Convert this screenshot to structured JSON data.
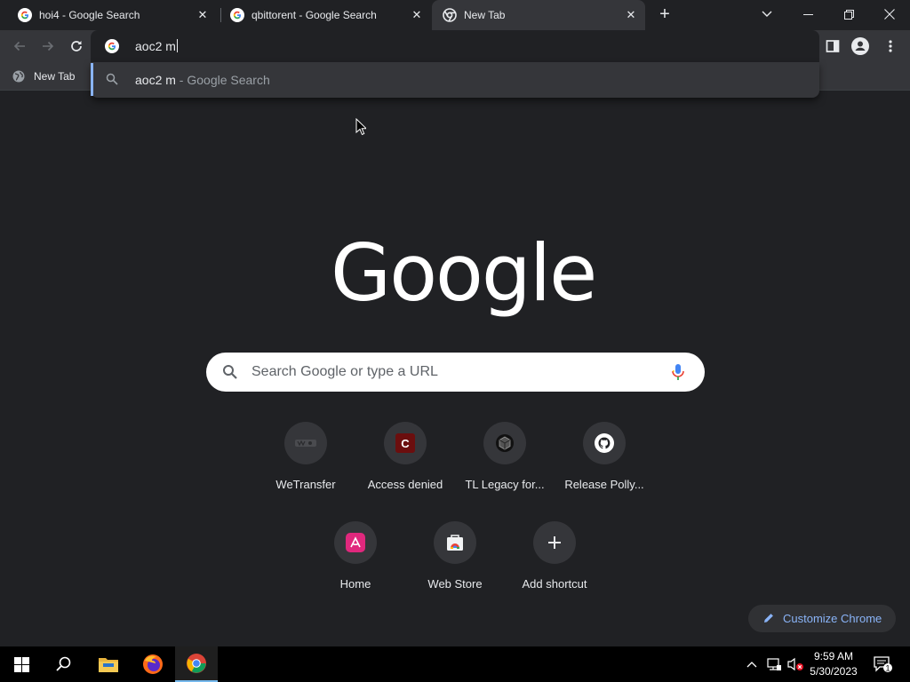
{
  "tabs": [
    {
      "title": "hoi4 - Google Search",
      "favicon": "google-g-icon",
      "active": false
    },
    {
      "title": "qbittorent - Google Search",
      "favicon": "google-g-icon",
      "active": false
    },
    {
      "title": "New Tab",
      "favicon": "chrome-icon",
      "active": true
    }
  ],
  "toolbar": {
    "omnibox_text": "aoc2 m"
  },
  "suggestion": {
    "query": "aoc2 m",
    "suffix": " - Google Search"
  },
  "bookmarks": [
    {
      "label": "New Tab",
      "icon": "globe-icon"
    }
  ],
  "page": {
    "logo": "Google",
    "search_placeholder": "Search Google or type a URL",
    "shortcuts": [
      {
        "label": "WeTransfer",
        "icon": "wetransfer-icon"
      },
      {
        "label": "Access denied",
        "icon": "c-letter-icon"
      },
      {
        "label": "TL Legacy for...",
        "icon": "tl-legacy-icon"
      },
      {
        "label": "Release Polly...",
        "icon": "github-icon"
      },
      {
        "label": "Home",
        "icon": "airtable-icon"
      },
      {
        "label": "Web Store",
        "icon": "webstore-icon"
      },
      {
        "label": "Add shortcut",
        "icon": "plus-icon"
      }
    ],
    "customize_label": "Customize Chrome"
  },
  "taskbar": {
    "time": "9:59 AM",
    "date": "5/30/2023",
    "notification_count": "1"
  },
  "colors": {
    "accent": "#8ab4f8",
    "tab_bg": "#35363a",
    "page_bg": "#202124"
  }
}
